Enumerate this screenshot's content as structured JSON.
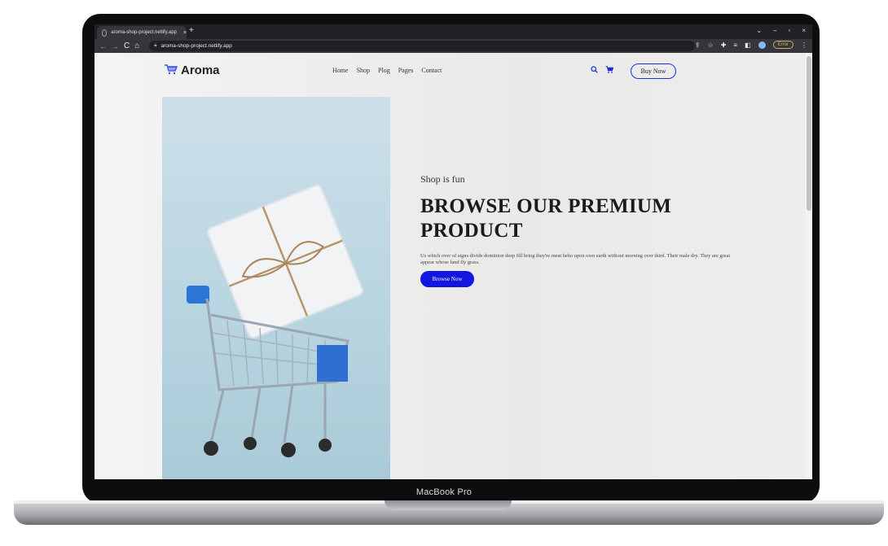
{
  "device": {
    "label": "MacBook Pro"
  },
  "browser": {
    "tab_title": "aroma-shop-project.netlify.app",
    "tab_close": "×",
    "new_tab": "+",
    "url": "aroma-shop-project.netlify.app",
    "error_badge": "Error",
    "nav": {
      "back": "←",
      "forward": "→",
      "reload": "C",
      "home": "⌂"
    },
    "window_controls": {
      "dropdown": "⌄",
      "minimize": "–",
      "restore": "▫",
      "close": "×"
    }
  },
  "site": {
    "logo_text": "Aroma",
    "menu": [
      "Home",
      "Shop",
      "Plog",
      "Pages",
      "Contact"
    ],
    "buy_now": "Buy Now",
    "hero": {
      "subtitle": "Shop is fun",
      "title": "BROWSE OUR PREMIUM PRODUCT",
      "description": "Us which over of signs divide dominion deep fill bring they're meat beho upon own earth without morning over third. Their male dry. They are great appear whose land fly grass.",
      "cta": "Browse Now"
    }
  },
  "colors": {
    "accent": "#1117e0",
    "chrome_dark": "#202124"
  },
  "icons": [
    "search-icon",
    "cart-icon",
    "logo-cart-icon",
    "lock-icon",
    "star-icon",
    "extension-icon"
  ]
}
